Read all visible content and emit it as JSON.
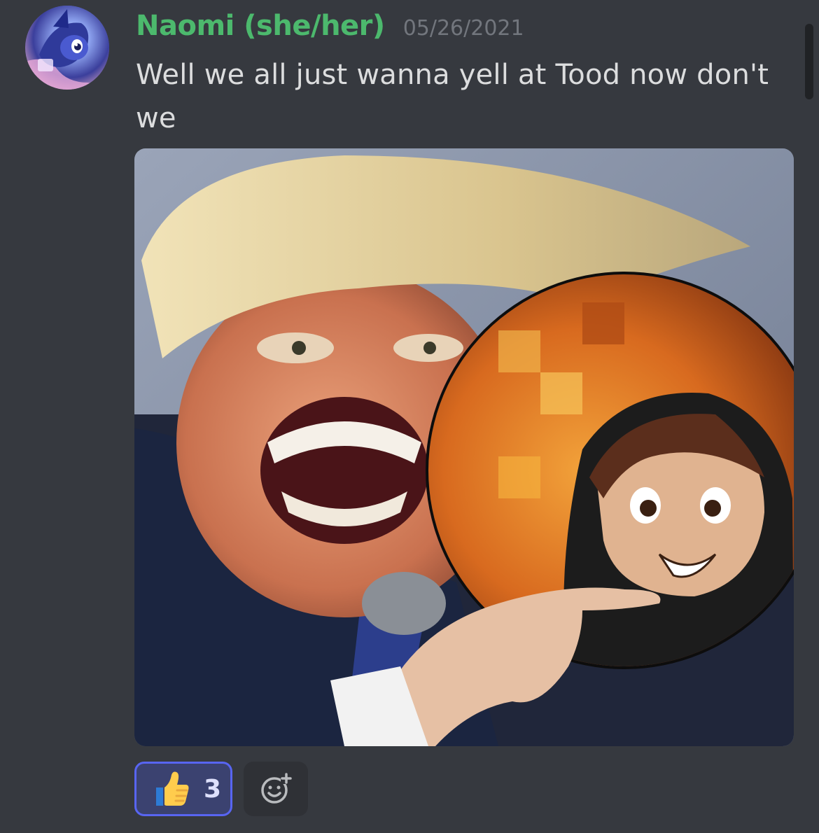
{
  "message": {
    "author": "Naomi (she/her)",
    "timestamp": "05/26/2021",
    "text": "Well we all just wanna yell at Tood now don't we",
    "author_color": "#4cb96d"
  },
  "avatar": {
    "icon": "pony-avatar-icon"
  },
  "attachment": {
    "kind": "image-meme"
  },
  "reactions": [
    {
      "emoji": "thumbs-up-icon",
      "count": "3",
      "selected": true
    }
  ],
  "add_reaction": {
    "icon": "add-reaction-icon"
  },
  "colors": {
    "background": "#36393f",
    "text": "#dcddde",
    "muted": "#72767d",
    "accent": "#5865f2"
  }
}
